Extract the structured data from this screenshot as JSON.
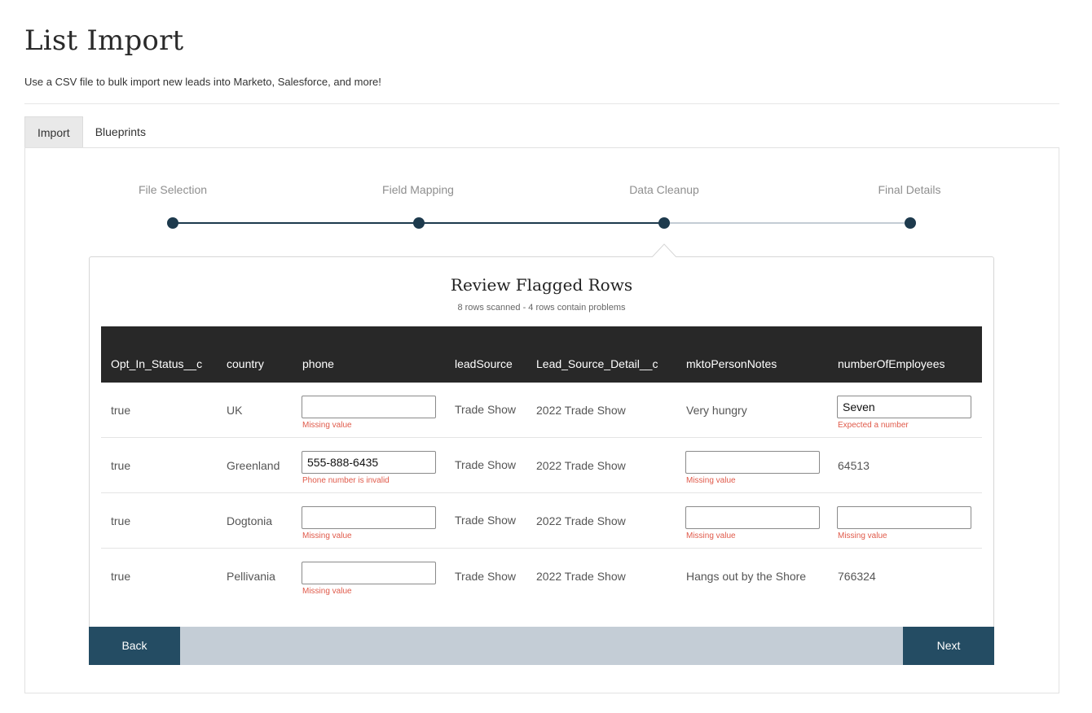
{
  "header": {
    "title": "List Import",
    "subtitle": "Use a CSV file to bulk import new leads into Marketo, Salesforce, and more!"
  },
  "tabs": [
    {
      "label": "Import",
      "active": true
    },
    {
      "label": "Blueprints",
      "active": false
    }
  ],
  "stepper": {
    "steps": [
      {
        "label": "File Selection",
        "state": "complete"
      },
      {
        "label": "Field Mapping",
        "state": "complete"
      },
      {
        "label": "Data Cleanup",
        "state": "current"
      },
      {
        "label": "Final Details",
        "state": "upcoming"
      }
    ]
  },
  "review": {
    "title": "Review Flagged Rows",
    "summary": "8 rows scanned - 4 rows contain problems"
  },
  "table": {
    "columns": [
      "Opt_In_Status__c",
      "country",
      "phone",
      "leadSource",
      "Lead_Source_Detail__c",
      "mktoPersonNotes",
      "numberOfEmployees"
    ],
    "rows": [
      {
        "opt_in": "true",
        "country": "UK",
        "phone": {
          "value": "",
          "error": "Missing value"
        },
        "lead_source": "Trade Show",
        "lead_source_detail": "2022 Trade Show",
        "notes": {
          "text": "Very hungry"
        },
        "employees": {
          "value": "Seven",
          "error": "Expected a number"
        }
      },
      {
        "opt_in": "true",
        "country": "Greenland",
        "phone": {
          "value": "555-888-6435",
          "error": "Phone number is invalid"
        },
        "lead_source": "Trade Show",
        "lead_source_detail": "2022 Trade Show",
        "notes": {
          "value": "",
          "error": "Missing value"
        },
        "employees": {
          "text": "64513"
        }
      },
      {
        "opt_in": "true",
        "country": "Dogtonia",
        "phone": {
          "value": "",
          "error": "Missing value"
        },
        "lead_source": "Trade Show",
        "lead_source_detail": "2022 Trade Show",
        "notes": {
          "value": "",
          "error": "Missing value"
        },
        "employees": {
          "value": "",
          "error": "Missing value"
        }
      },
      {
        "opt_in": "true",
        "country": "Pellivania",
        "phone": {
          "value": "",
          "error": "Missing value"
        },
        "lead_source": "Trade Show",
        "lead_source_detail": "2022 Trade Show",
        "notes": {
          "text": "Hangs out by the Shore"
        },
        "employees": {
          "text": "766324"
        }
      }
    ]
  },
  "footer": {
    "back_label": "Back",
    "next_label": "Next"
  },
  "colors": {
    "primary": "#244c63",
    "step_complete": "#1d3a4d",
    "step_upcoming": "#c3ccd4",
    "error": "#e05a4a",
    "table_header": "#282828"
  }
}
